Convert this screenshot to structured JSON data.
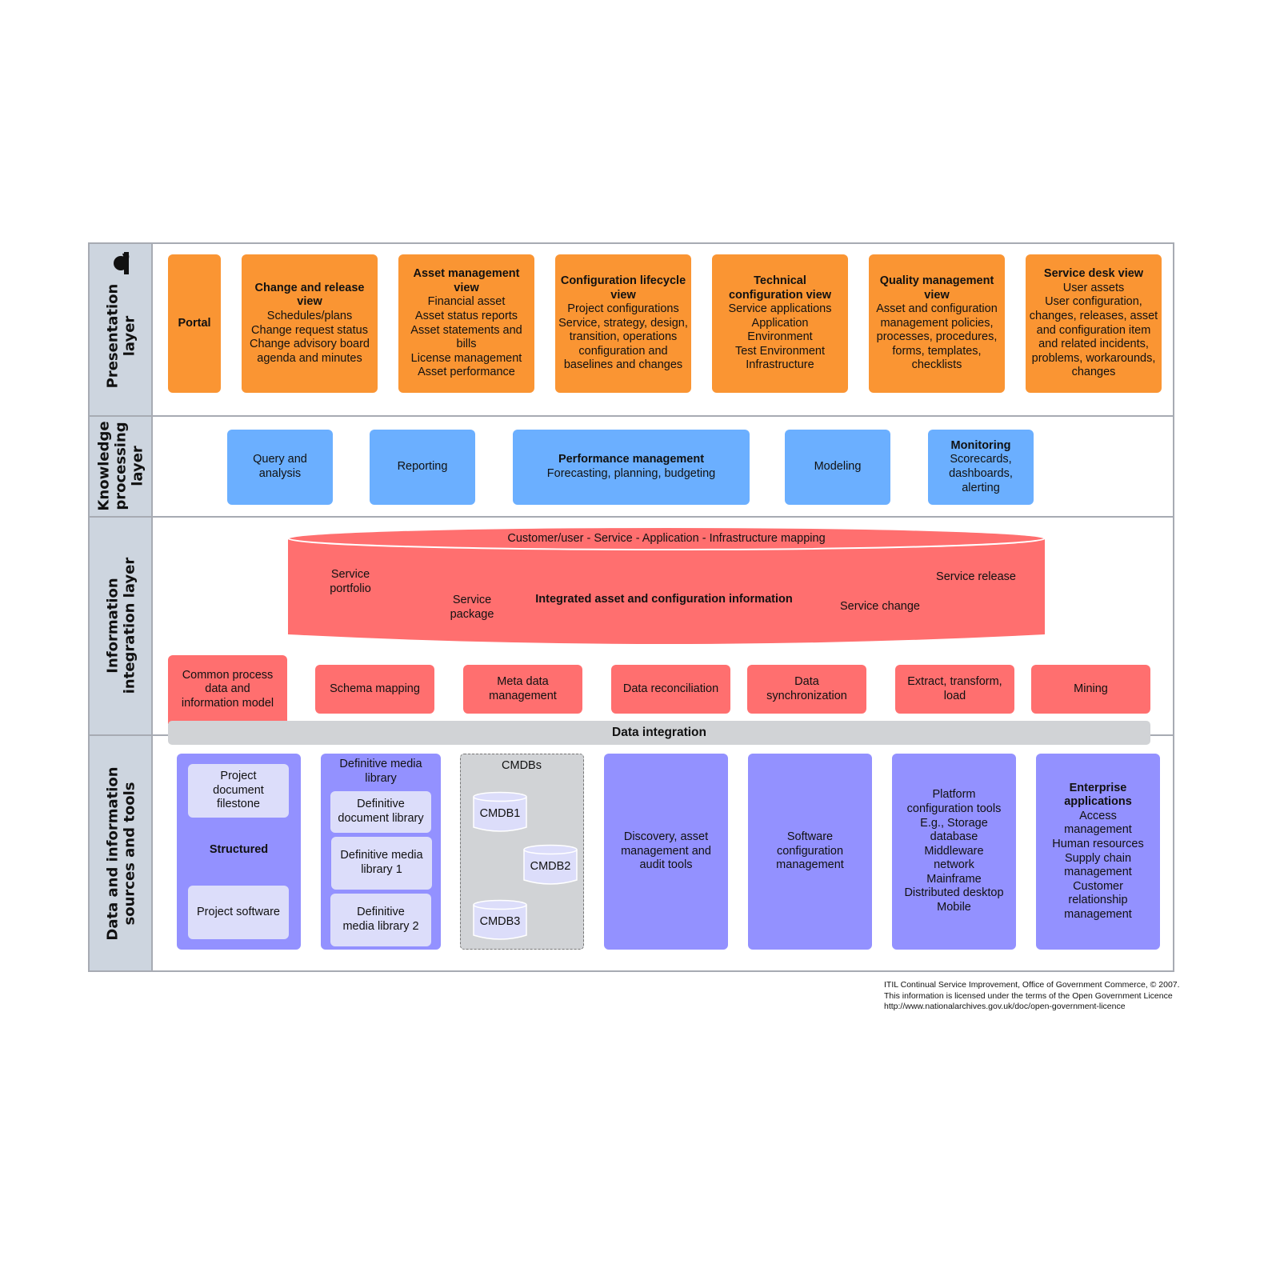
{
  "colors": {
    "presentation": "#fa9533",
    "knowledge": "#6bafff",
    "integration": "#ff6f6f",
    "sources": "#9391ff",
    "sources_inner": "#dcddfa",
    "data_integration": "#d1d3d6",
    "header_column": "#cdd5df",
    "border": "#a7abb3"
  },
  "rows": [
    {
      "label": "Presentation\nlayer",
      "icon": "person-icon"
    },
    {
      "label": "Knowledge\nprocessing\nlayer"
    },
    {
      "label": "Information\nintegration layer"
    },
    {
      "label": "Data and information\nsources and tools"
    }
  ],
  "presentation": [
    {
      "title": "Portal",
      "lines": []
    },
    {
      "title": "Change and release view",
      "lines": [
        "Schedules/plans",
        "Change request status",
        "Change advisory board agenda and minutes"
      ]
    },
    {
      "title": "Asset management view",
      "lines": [
        "Financial asset",
        "Asset status reports",
        "Asset statements and bills",
        "License management",
        "Asset performance"
      ]
    },
    {
      "title": "Configuration lifecycle view",
      "lines": [
        "Project configurations",
        "Service, strategy, design, transition, operations configuration and baselines and changes"
      ]
    },
    {
      "title": "Technical configuration view",
      "lines": [
        "Service applications",
        "Application",
        "Environment",
        "Test Environment",
        "Infrastructure"
      ]
    },
    {
      "title": "Quality management view",
      "lines": [
        "Asset and configuration management policies, processes, procedures, forms, templates, checklists"
      ]
    },
    {
      "title": "Service desk view",
      "lines": [
        "User assets",
        "User configuration, changes, releases, asset and configuration item and related incidents, problems, workarounds, changes"
      ]
    }
  ],
  "knowledge": [
    {
      "title": "",
      "lines": [
        "Query and analysis"
      ]
    },
    {
      "title": "",
      "lines": [
        "Reporting"
      ]
    },
    {
      "title": "Performance management",
      "lines": [
        "Forecasting, planning, budgeting"
      ]
    },
    {
      "title": "",
      "lines": [
        "Modeling"
      ]
    },
    {
      "title": "Monitoring",
      "lines": [
        "Scorecards, dashboards, alerting"
      ]
    }
  ],
  "integration": {
    "cylinder": {
      "top_label": "Customer/user - Service - Application - Infrastructure mapping",
      "center_label": "Integrated asset and configuration information",
      "service_portfolio": "Service\nportfolio",
      "service_package": "Service\npackage",
      "service_change": "Service change",
      "service_release": "Service release"
    },
    "common_model": "Common process data and information model",
    "functions": [
      "Schema mapping",
      "Meta data management",
      "Data reconciliation",
      "Data synchronization",
      "Extract, transform, load",
      "Mining"
    ],
    "data_integration": "Data integration"
  },
  "sources": {
    "structured": {
      "label": "Structured",
      "top": "Project document filestone",
      "bottom": "Project software"
    },
    "dml": {
      "title": "Definitive media library",
      "items": [
        "Definitive document library",
        "Definitive media library 1",
        "Definitive media library 2"
      ]
    },
    "cmdbs": {
      "title": "CMDBs",
      "items": [
        "CMDB1",
        "CMDB2",
        "CMDB3"
      ]
    },
    "discovery": "Discovery, asset management and audit tools",
    "software_cm": "Software configuration management",
    "platform": {
      "lines": [
        "Platform configuration tools",
        "E.g., Storage database",
        "Middleware network",
        "Mainframe",
        "Distributed desktop",
        "Mobile"
      ]
    },
    "enterprise": {
      "title": "Enterprise applications",
      "lines": [
        "Access management",
        "Human resources",
        "Supply chain management",
        "Customer relationship management"
      ]
    }
  },
  "footer": [
    "ITIL Continual Service Improvement, Office of Government Commerce, © 2007.",
    "This information is licensed under the terms of the Open Government Licence",
    "http://www.nationalarchives.gov.uk/doc/open-government-licence"
  ]
}
